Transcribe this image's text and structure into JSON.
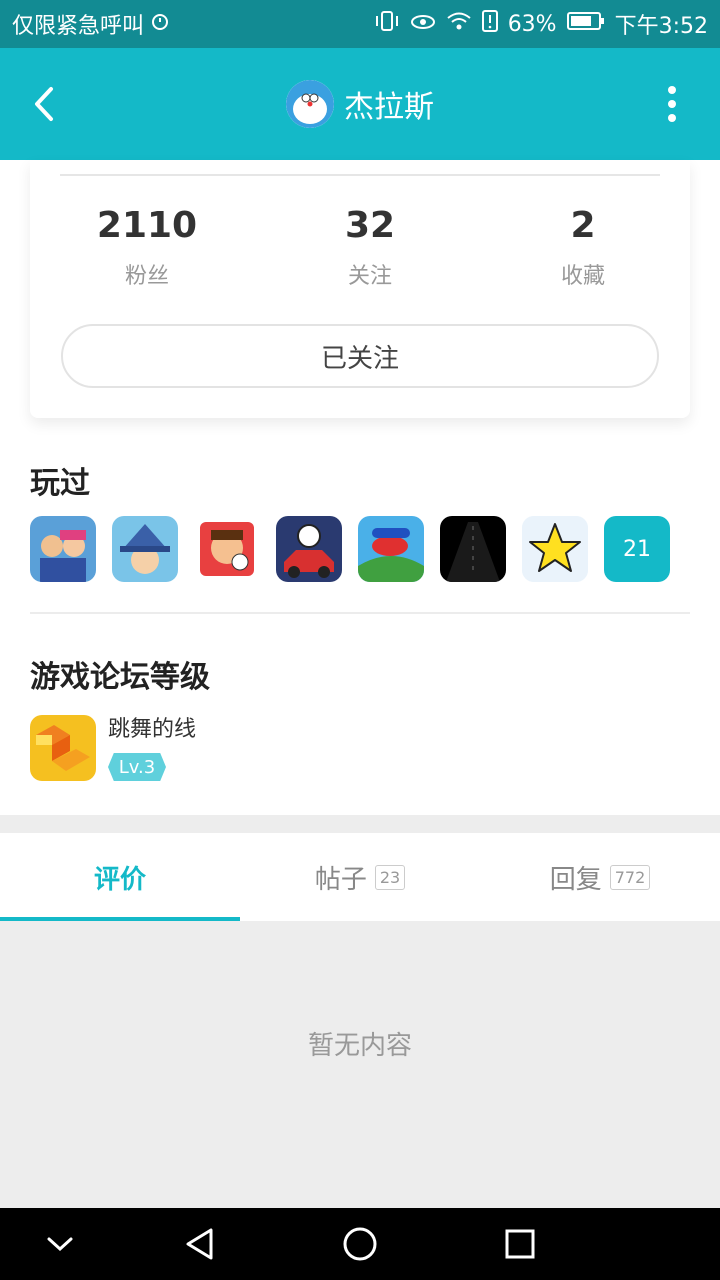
{
  "status_bar": {
    "left_text": "仅限紧急呼叫",
    "battery": "63%",
    "time": "下午3:52"
  },
  "header": {
    "title": "杰拉斯"
  },
  "stats": [
    {
      "value": "2110",
      "label": "粉丝"
    },
    {
      "value": "32",
      "label": "关注"
    },
    {
      "value": "2",
      "label": "收藏"
    }
  ],
  "follow_button": "已关注",
  "played": {
    "title": "玩过",
    "more_count": "21"
  },
  "forum": {
    "title": "游戏论坛等级",
    "game_name": "跳舞的线",
    "level": "Lv.3"
  },
  "tabs": [
    {
      "label": "评价",
      "count": ""
    },
    {
      "label": "帖子",
      "count": "23"
    },
    {
      "label": "回复",
      "count": "772"
    }
  ],
  "empty_text": "暂无内容",
  "colors": {
    "accent": "#14b9c8",
    "status_bar": "#128b93"
  }
}
